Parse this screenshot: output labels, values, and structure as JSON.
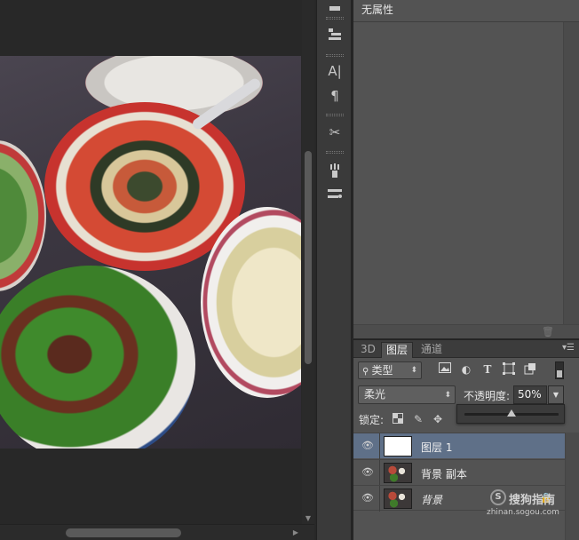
{
  "properties_panel": {
    "title": "无属性"
  },
  "layers_panel": {
    "tabs": [
      {
        "label": "3D",
        "active": false
      },
      {
        "label": "图层",
        "active": true
      },
      {
        "label": "通道",
        "active": false
      }
    ],
    "filter": {
      "label": "类型",
      "icons": [
        "image-filter-icon",
        "adjustment-filter-icon",
        "type-filter-icon",
        "shape-filter-icon",
        "smart-object-filter-icon"
      ]
    },
    "blend_mode": "柔光",
    "opacity_label": "不透明度:",
    "opacity_value": "50%",
    "opacity_slider_fraction": 0.5,
    "lock_label": "锁定:",
    "layers": [
      {
        "name": "图层 1",
        "selected": true,
        "visible": true,
        "thumbnail": "white"
      },
      {
        "name": "背景 副本",
        "selected": false,
        "visible": true,
        "thumbnail": "photo"
      },
      {
        "name": "背景",
        "selected": false,
        "visible": true,
        "thumbnail": "photo",
        "locked": true
      }
    ]
  },
  "toolstrip": {
    "tools": [
      "history-icon",
      "layer-comps-icon",
      "character-icon",
      "paragraph-icon",
      "tools-preset-icon",
      "brush-icon",
      "brush-preset-icon"
    ]
  },
  "watermark": {
    "badge": "S",
    "text": "搜狗指南",
    "url": "zhinan.sogou.com"
  },
  "colors": {
    "panel": "#535353",
    "dark": "#282828",
    "selected_layer": "#5f7088"
  }
}
